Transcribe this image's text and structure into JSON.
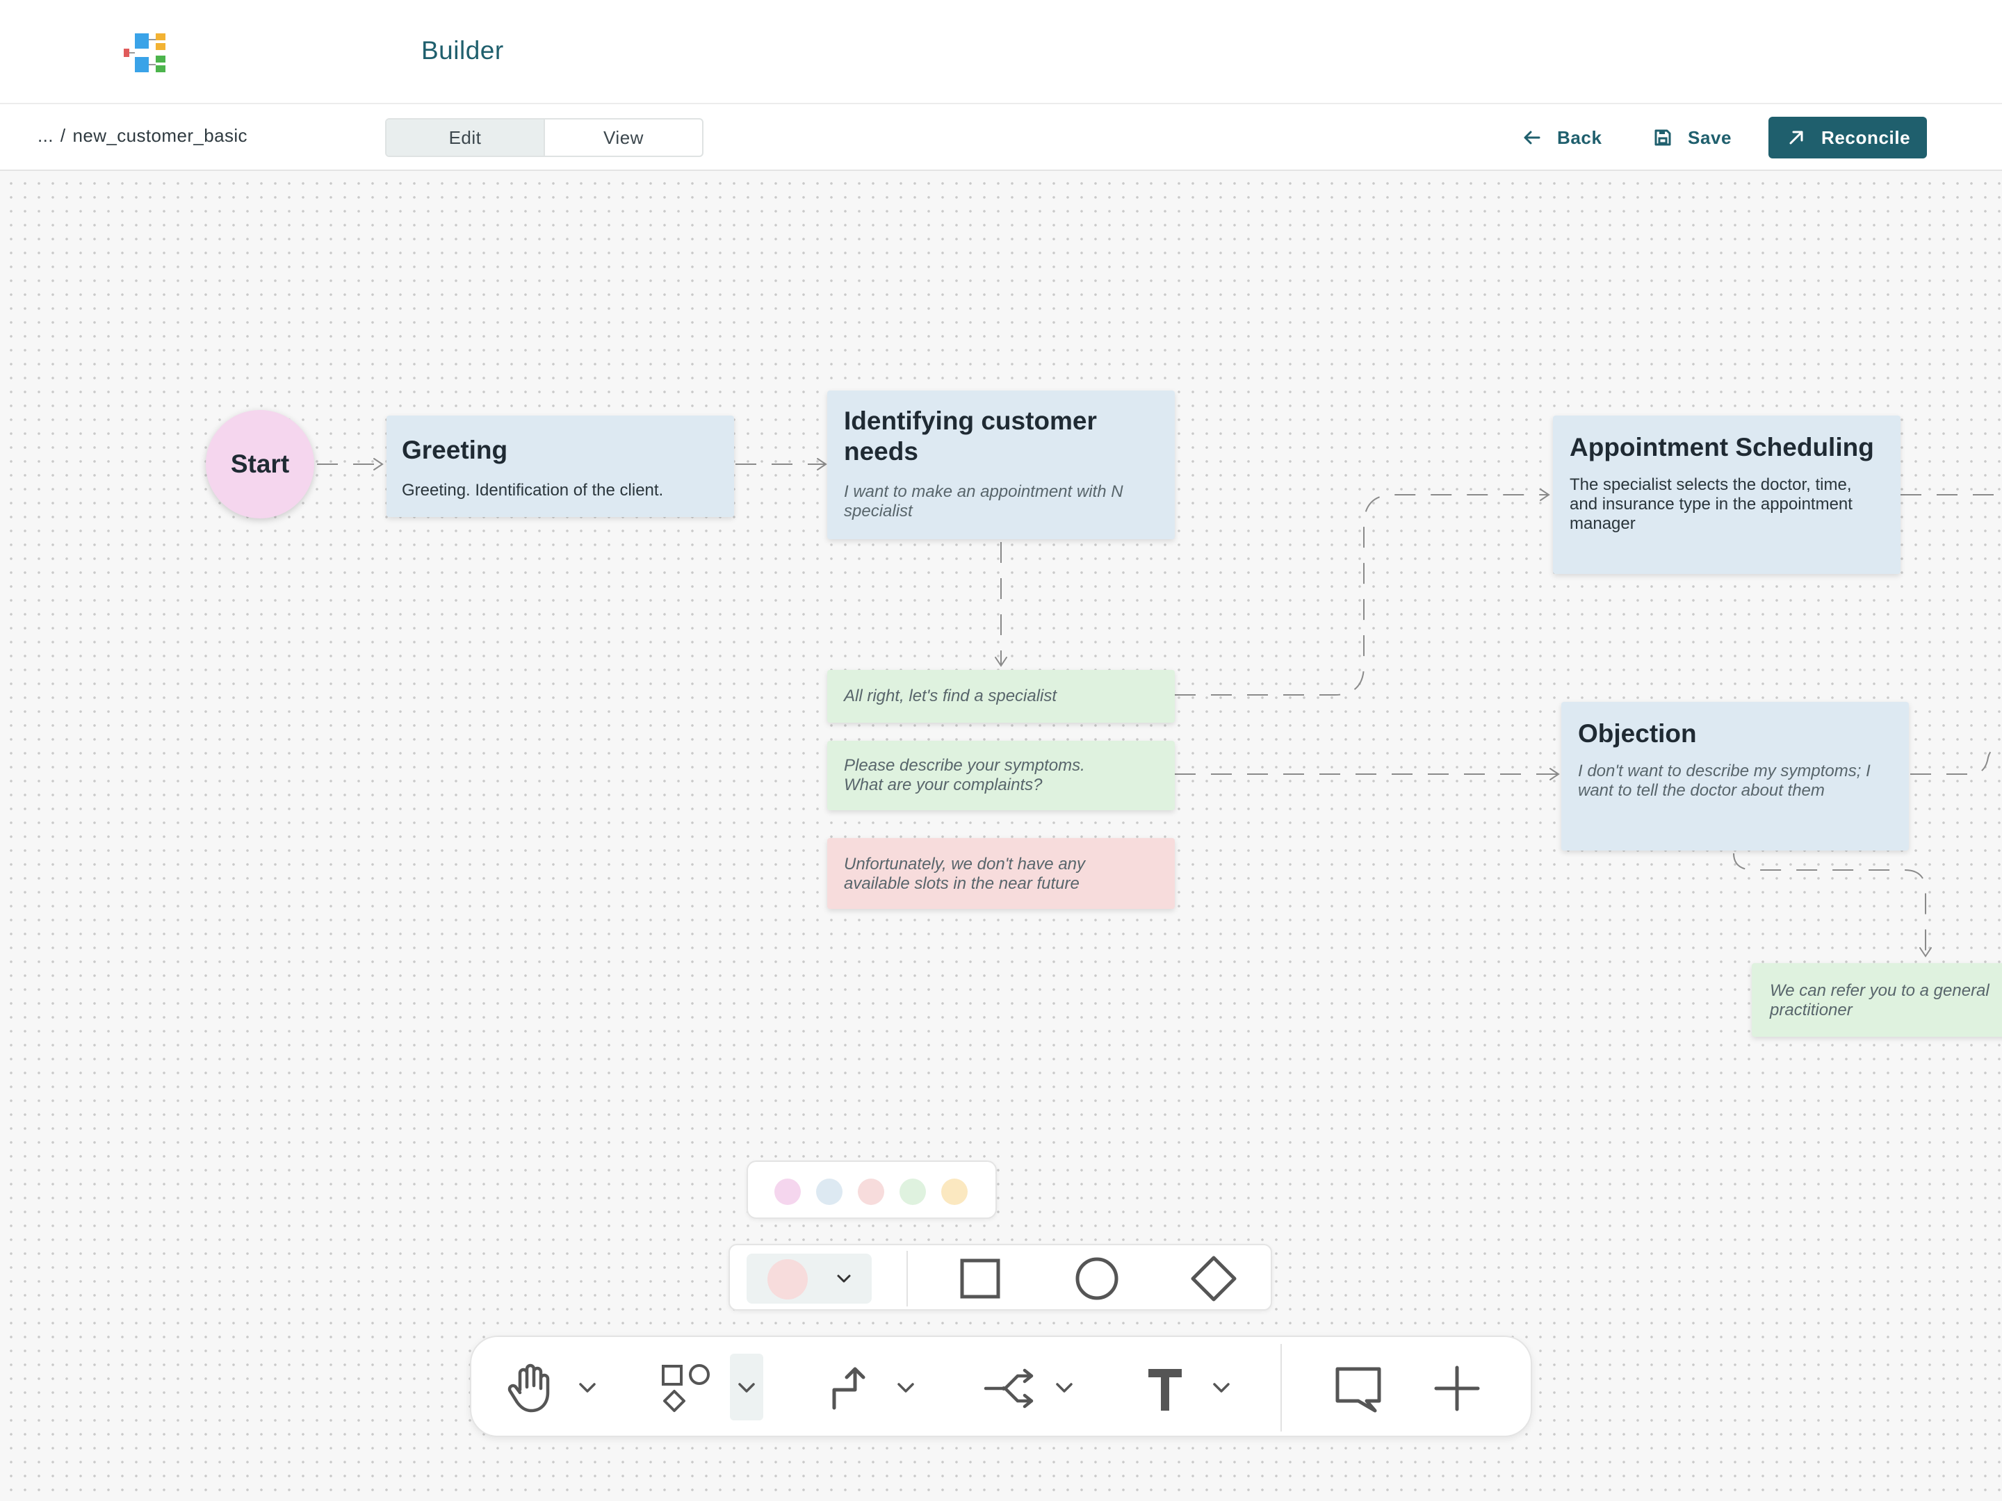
{
  "app": {
    "title": "Builder"
  },
  "breadcrumb": {
    "ellipsis": "...",
    "separator": "/",
    "current": "new_customer_basic"
  },
  "mode_switch": {
    "edit": "Edit",
    "view": "View",
    "active": "edit"
  },
  "actions": {
    "back": "Back",
    "save": "Save",
    "reconcile": "Reconcile"
  },
  "colors": {
    "accent": "#1f5f6d",
    "node_blue": "#dde9f2",
    "node_green": "#dff2df",
    "node_red": "#f7dcdc",
    "start_pink": "#f5d6ee"
  },
  "flow": {
    "start": {
      "label": "Start"
    },
    "greeting": {
      "title": "Greeting",
      "text": "Greeting. Identification of the client."
    },
    "needs": {
      "title_line1": "Identifying customer",
      "title_line2": "needs",
      "text_line1": "I want to make an appointment with N",
      "text_line2": "specialist"
    },
    "answer_find": {
      "text": "All right, let's find a specialist"
    },
    "answer_describe": {
      "line1": "Please describe your symptoms.",
      "line2": "What are your complaints?"
    },
    "answer_noslots": {
      "line1": "Unfortunately, we don't have any",
      "line2": "available slots in the near future"
    },
    "appointment": {
      "title": "Appointment Scheduling",
      "line1": "The specialist selects the doctor, time,",
      "line2": "and insurance type in the appointment",
      "line3": "manager"
    },
    "objection": {
      "title": "Objection",
      "line1": "I don't want to describe my symptoms; I",
      "line2": "want to tell the doctor about them"
    },
    "refer": {
      "line1": "We can refer you to a general",
      "line2": "practitioner"
    }
  },
  "palette": {
    "swatches": [
      "#f5d6ee",
      "#dde9f2",
      "#f7dcdc",
      "#dff2df",
      "#fbe8c0"
    ]
  },
  "shape_toolbar": {
    "selected_color": "#f7dcdc",
    "shapes": [
      "square-icon",
      "circle-icon",
      "diamond-icon"
    ]
  },
  "main_toolbar": {
    "tools": [
      "hand-icon",
      "shapes-icon",
      "connector-icon",
      "branch-icon",
      "text-icon",
      "comment-icon",
      "plus-icon"
    ]
  }
}
